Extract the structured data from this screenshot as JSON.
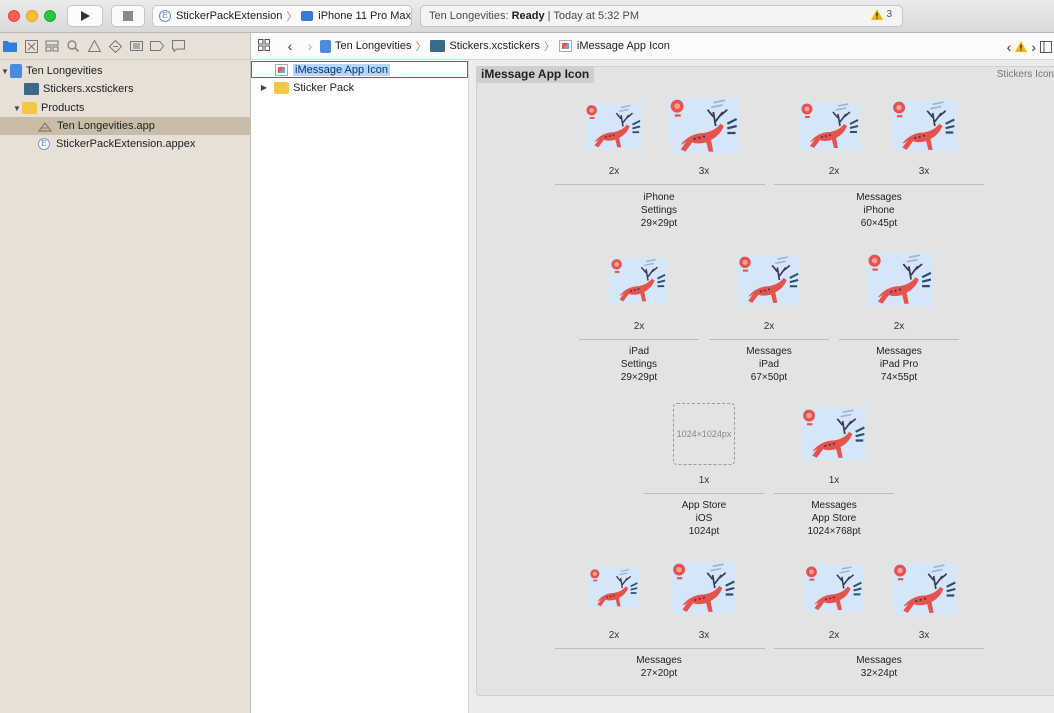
{
  "toolbar": {
    "scheme": "StickerPackExtension",
    "device": "iPhone 11 Pro Max",
    "activity_project": "Ten Longevities:",
    "activity_status": "Ready",
    "activity_time": "| Today at 5:32 PM",
    "warning_count": "3"
  },
  "navigator": {
    "project": "Ten Longevities",
    "stickers": "Stickers.xcstickers",
    "products": "Products",
    "app": "Ten Longevities.app",
    "appex": "StickerPackExtension.appex"
  },
  "jumpbar": {
    "crumb1": "Ten Longevities",
    "crumb2": "Stickers.xcstickers",
    "crumb3": "iMessage App Icon"
  },
  "outline": {
    "item1": "iMessage App Icon",
    "item2": "Sticker Pack"
  },
  "canvas": {
    "title": "iMessage App Icon",
    "type_label": "Stickers Icon",
    "placeholder": "1024×1024px",
    "scales": {
      "s2x": "2x",
      "s3x": "3x",
      "s1x": "1x"
    },
    "groups": [
      {
        "l1": "iPhone",
        "l2": "Settings",
        "l3": "29×29pt"
      },
      {
        "l1": "Messages",
        "l2": "iPhone",
        "l3": "60×45pt"
      },
      {
        "l1": "iPad",
        "l2": "Settings",
        "l3": "29×29pt"
      },
      {
        "l1": "Messages",
        "l2": "iPad",
        "l3": "67×50pt"
      },
      {
        "l1": "Messages",
        "l2": "iPad Pro",
        "l3": "74×55pt"
      },
      {
        "l1": "App Store",
        "l2": "iOS",
        "l3": "1024pt"
      },
      {
        "l1": "Messages",
        "l2": "App Store",
        "l3": "1024×768pt"
      },
      {
        "l1": "Messages",
        "l2": "27×20pt",
        "l3": ""
      },
      {
        "l1": "Messages",
        "l2": "32×24pt",
        "l3": ""
      }
    ]
  }
}
